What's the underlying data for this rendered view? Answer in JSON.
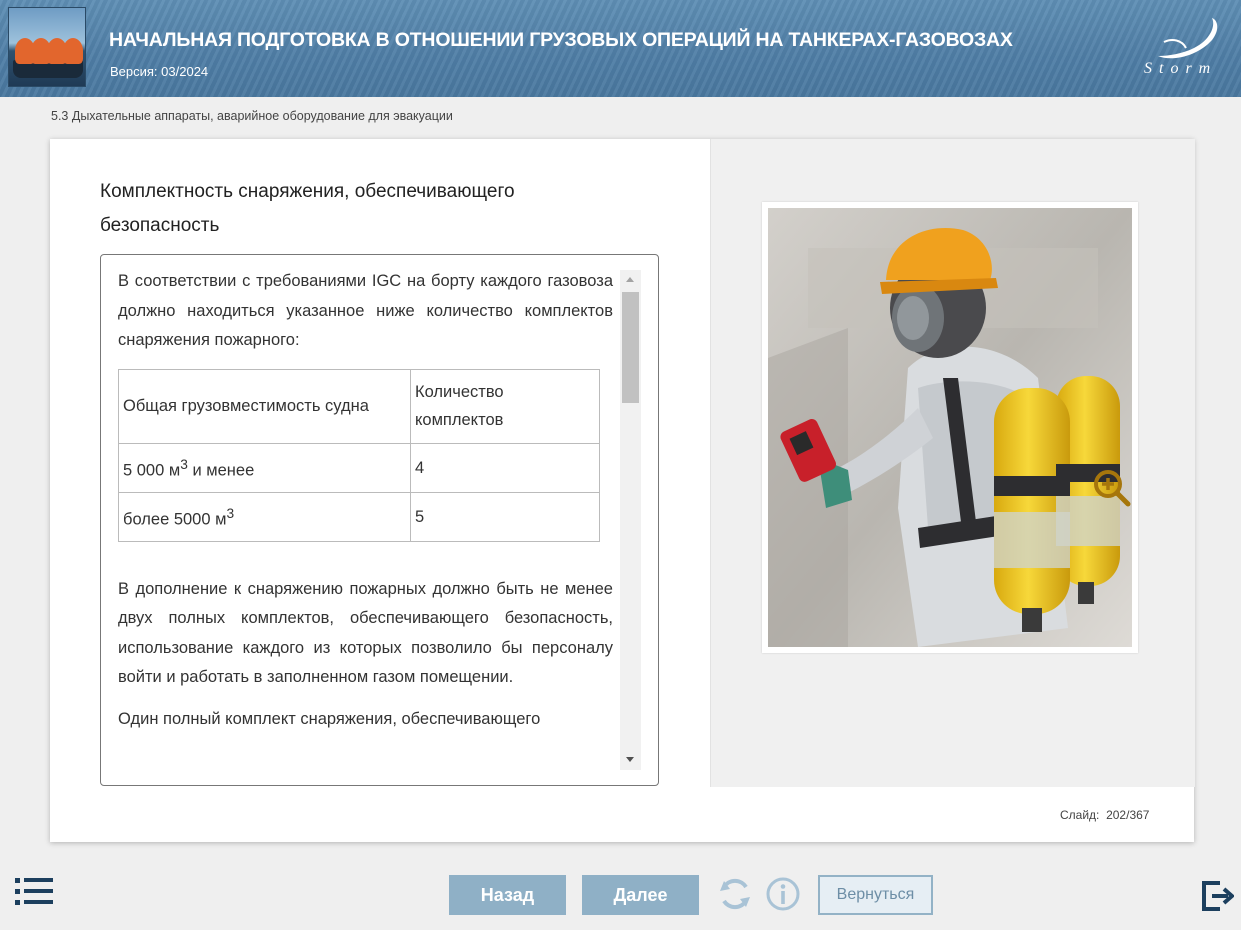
{
  "header": {
    "title": "НАЧАЛЬНАЯ ПОДГОТОВКА В ОТНОШЕНИИ ГРУЗОВЫХ ОПЕРАЦИЙ НА ТАНКЕРАХ-ГАЗОВОЗАХ",
    "version": "Версия: 03/2024",
    "logo_text": "Storm",
    "logo_icon": "storm-logo-icon"
  },
  "breadcrumb": "5.3 Дыхательные аппараты, аварийное оборудование для эвакуации",
  "content": {
    "heading": "Комплектность снаряжения, обеспечивающего безопасность",
    "intro": "В соответствии с требованиями IGC на борту каждого газовоза должно находиться указанное ниже количество комплектов снаряжения пожарного:",
    "table": {
      "header": [
        "Общая грузовместимость судна",
        "Количество комплектов"
      ],
      "rows": [
        {
          "capacity": "5 000 м",
          "sup": "3",
          "suffix": " и менее",
          "count": "4"
        },
        {
          "capacity": "более 5000 м",
          "sup": "3",
          "suffix": "",
          "count": "5"
        }
      ]
    },
    "para2": "В дополнение к снаряжению пожарных должно быть не менее двух полных комплектов, обеспечивающего безопасность, использование каждого из которых позволило бы персоналу войти и работать в заполненном газом помещении.",
    "para3": "Один полный комплект снаряжения, обеспечивающего"
  },
  "image": {
    "zoom_icon": "zoom-in-icon"
  },
  "slide": {
    "label": "Слайд:",
    "current": "202",
    "total": "367"
  },
  "footer": {
    "back_label": "Назад",
    "next_label": "Далее",
    "return_label": "Вернуться",
    "icons": [
      "menu-list-icon",
      "refresh-icon",
      "info-icon",
      "exit-icon"
    ]
  },
  "colors": {
    "header_bg": "#4f7ea6",
    "button_bg": "#8fb0c6",
    "icon_color": "#1c3f5e",
    "helmet": "#f0a11e",
    "tank": "#f2cc1d"
  }
}
